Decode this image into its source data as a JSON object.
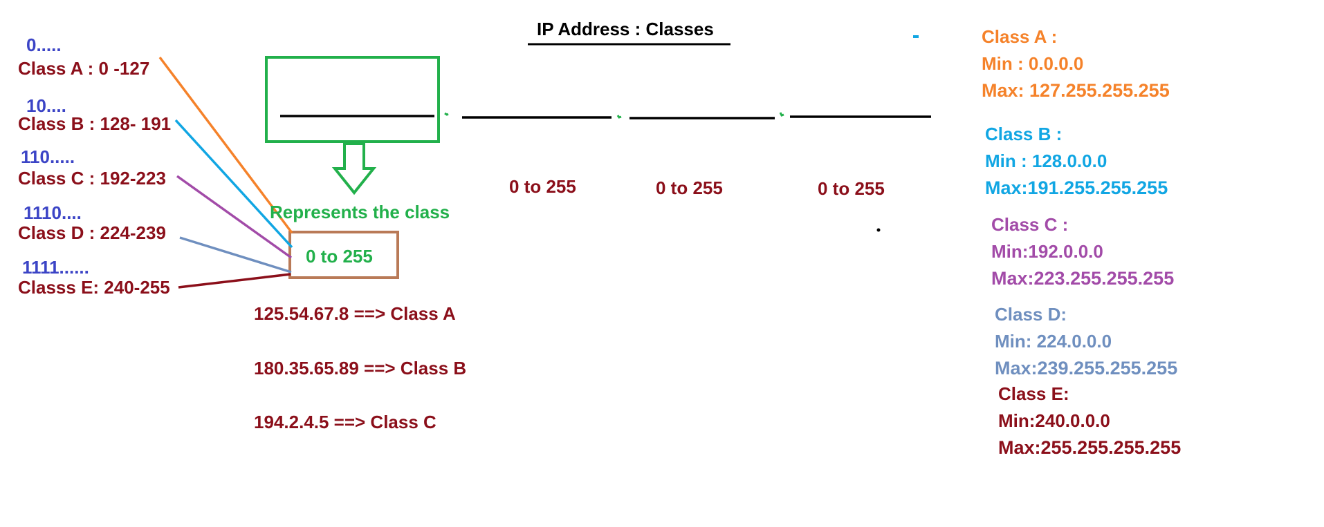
{
  "title": "IP Address : Classes",
  "class_list": [
    {
      "prefix": "0.....",
      "label": "Class A :  0 -127"
    },
    {
      "prefix": "10....",
      "label": "Class B : 128- 191"
    },
    {
      "prefix": "110.....",
      "label": "Class C : 192-223"
    },
    {
      "prefix": "1110....",
      "label": "Class D : 224-239"
    },
    {
      "prefix": "1111......",
      "label": "Classs E: 240-255"
    }
  ],
  "octet_ranges": [
    "0 to 255",
    "0 to 255",
    "0 to 255"
  ],
  "represents_label": "Represents the class",
  "first_octet_range": "0 to 255",
  "examples": [
    "125.54.67.8 ==> Class A",
    "180.35.65.89 ==> Class B",
    "194.2.4.5 ==> Class C"
  ],
  "class_details": [
    {
      "name": "Class A :",
      "min": "Min : 0.0.0.0",
      "max": "Max: 127.255.255.255",
      "color": "#f5822a"
    },
    {
      "name": "Class B :",
      "min": "Min : 128.0.0.0",
      "max": "Max:191.255.255.255",
      "color": "#11a6e3"
    },
    {
      "name": "Class C :",
      "min": "Min:192.0.0.0",
      "max": "Max:223.255.255.255",
      "color": "#a24ba8"
    },
    {
      "name": "Class D:",
      "min": "Min: 224.0.0.0",
      "max": "Max:239.255.255.255",
      "color": "#6f8fbf"
    },
    {
      "name": "Class E:",
      "min": "Min:240.0.0.0",
      "max": "Max:255.255.255.255",
      "color": "#8b0f1a"
    }
  ],
  "colors": {
    "maroon": "#8b0f1a",
    "prefix_blue": "#3b44c6",
    "green": "#22b04b",
    "brown_box": "#b97a57",
    "orange": "#f5822a",
    "cyan": "#11a6e3",
    "purple": "#a24ba8",
    "steel": "#6f8fbf"
  }
}
